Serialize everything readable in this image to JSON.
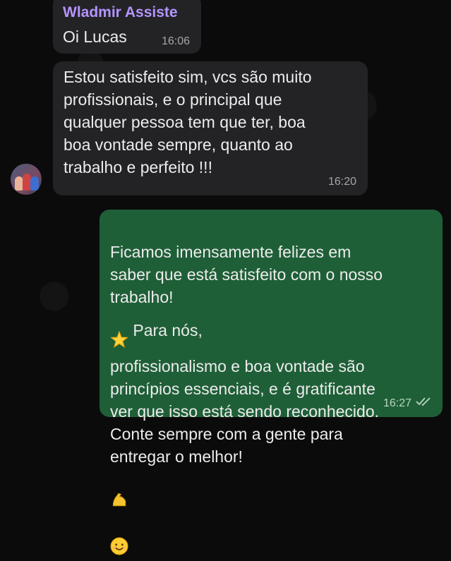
{
  "messages": [
    {
      "sender": "Wladmir Assiste",
      "text": "Oi Lucas",
      "time": "16:06"
    },
    {
      "text": "Estou satisfeito sim, vcs são muito\nprofissionais, e o principal que\nqualquer  pessoa tem que ter, boa\nboa vontade sempre, quanto ao\ntrabalho e perfeito !!!",
      "time": "16:20",
      "avatar_icon": "contact-avatar"
    },
    {
      "text_part1": "Ficamos imensamente felizes em\nsaber que está satisfeito com o nosso\ntrabalho!",
      "emoji_star": "star-emoji",
      "text_part2": " Para nós,\nprofissionalismo e boa vontade são\nprincípios essenciais, e é gratificante\nver que isso está sendo reconhecido.\nConte sempre com a gente para\nentregar o melhor!",
      "emoji_end": [
        "flexed-biceps-emoji",
        "smiling-face-emoji"
      ],
      "time": "16:27",
      "status_icon": "double-check-icon"
    }
  ],
  "colors": {
    "incoming_bubble": "#232326",
    "outgoing_bubble": "#1f5f38",
    "sender_name": "#b594ff",
    "background": "#0b0b0b"
  }
}
